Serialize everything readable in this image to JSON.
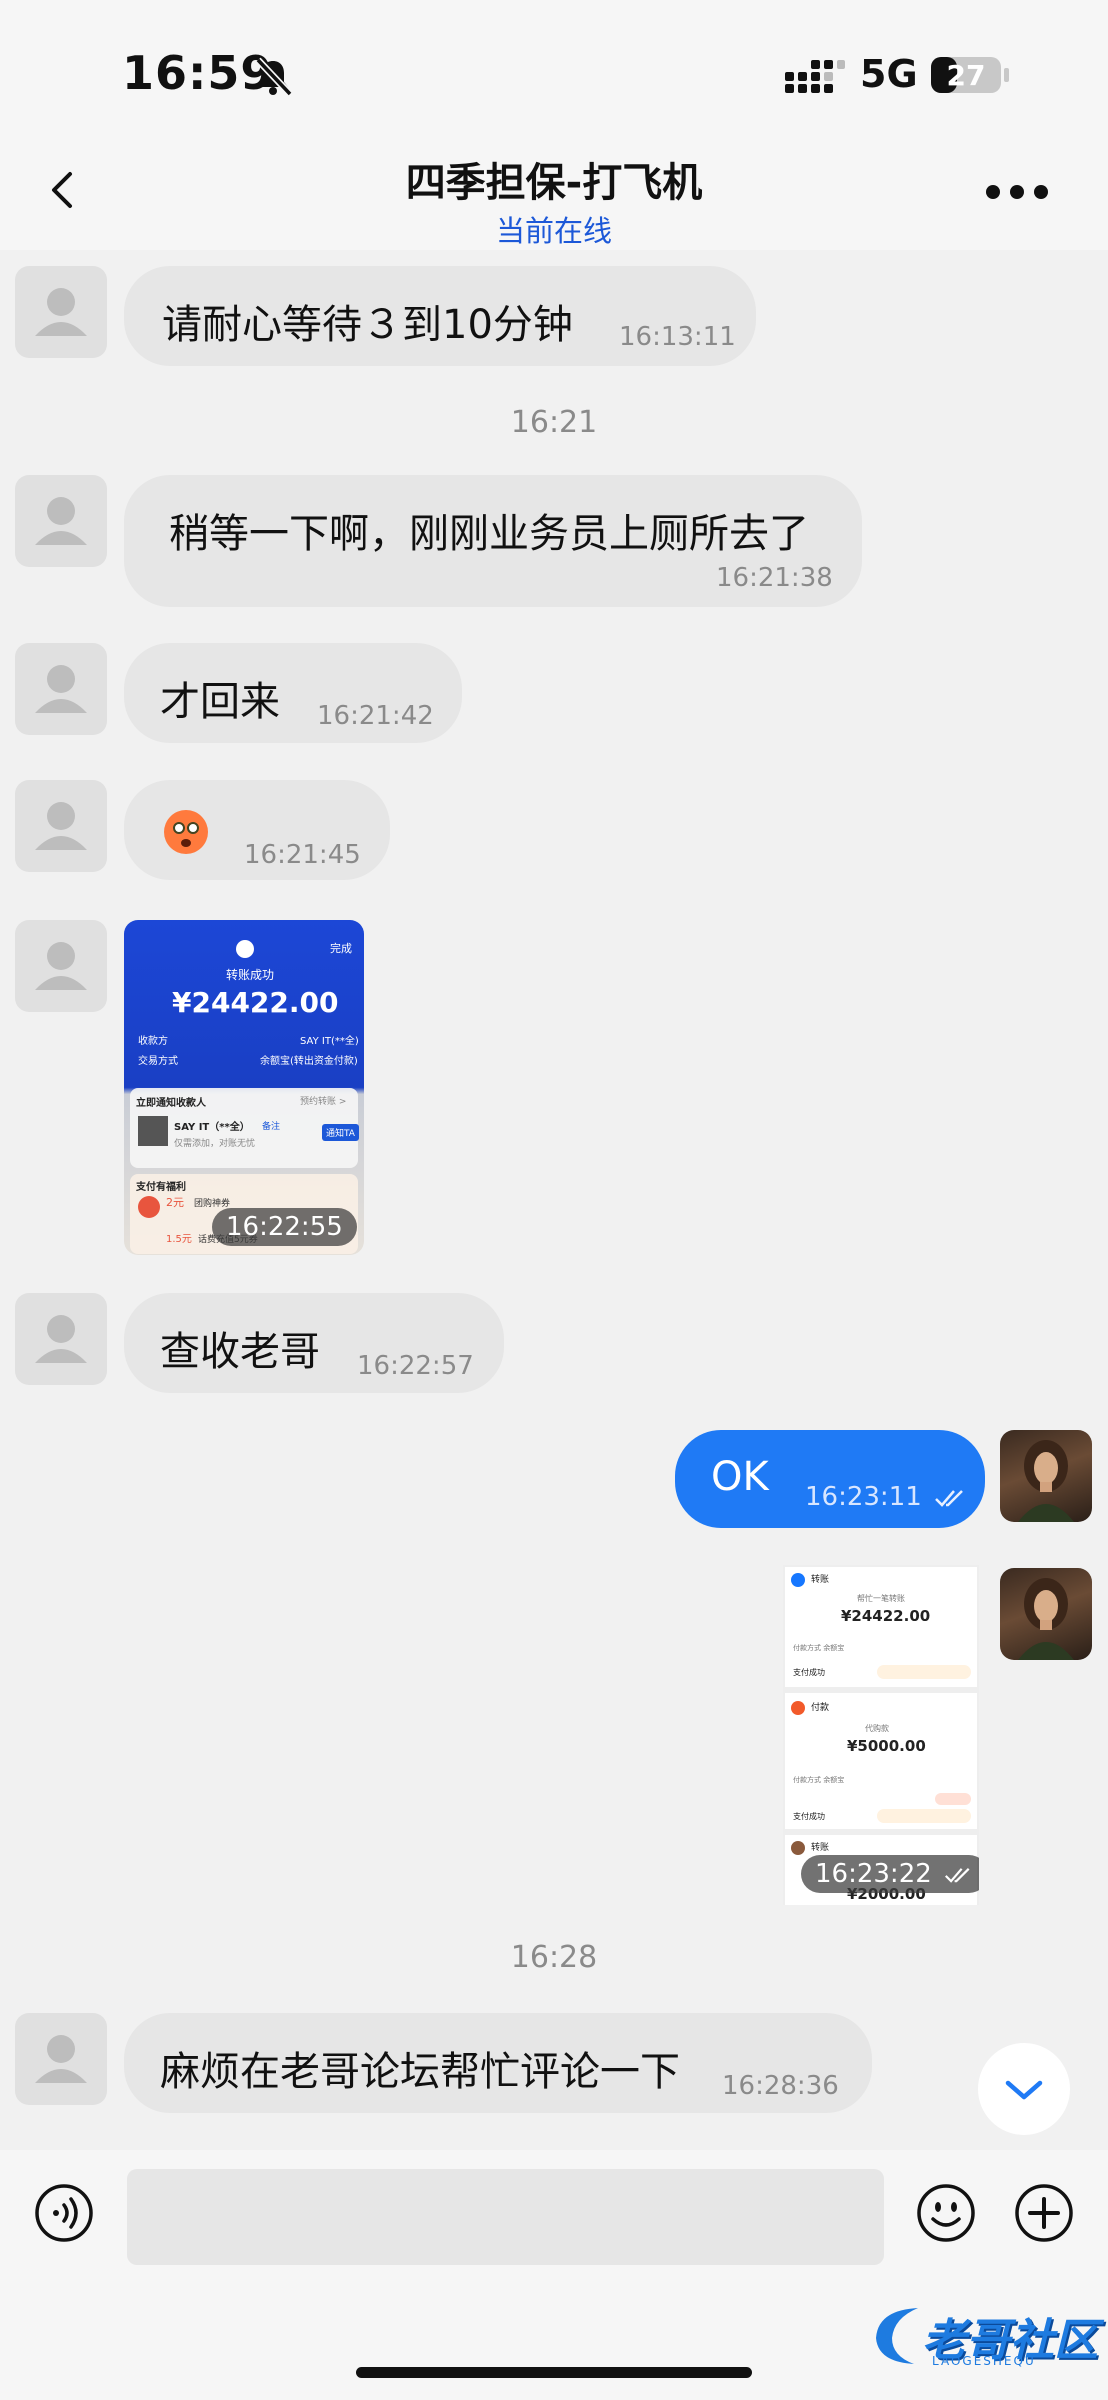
{
  "status_bar": {
    "time": "16:59",
    "network": "5G",
    "battery": "27"
  },
  "header": {
    "title": "四季担保-打飞机",
    "subtitle": "当前在线"
  },
  "messages": {
    "m1": {
      "text": "请耐心等待３到10分钟",
      "time": "16:13:11"
    },
    "sep1": "16:21",
    "m2": {
      "text": "稍等一下啊，刚刚业务员上厕所去了",
      "time": "16:21:38"
    },
    "m3": {
      "text": "才回来",
      "time": "16:21:42"
    },
    "m4": {
      "time": "16:21:45"
    },
    "m5": {
      "time": "16:22:55",
      "image": {
        "status": "转账成功",
        "amount": "¥24422.00",
        "done": "完成",
        "payee_label": "收款方",
        "payee_value": "SAY IT(**全)",
        "method_label": "交易方式",
        "method_value": "余额宝(转出资金付款)",
        "notify": "立即通知收款人",
        "remind": "预约转账 >",
        "contact": "SAY IT（**全）",
        "contact_tag": "备注",
        "contact_desc": "仅需添加，对账无忧",
        "notify_btn": "通知TA",
        "benefit": "支付有福利",
        "coupon1": "2元",
        "coupon1_desc": "团购神券",
        "coupon2": "1.5元",
        "coupon2_desc": "话费充值5元券"
      }
    },
    "m6": {
      "text": "查收老哥",
      "time": "16:22:57"
    },
    "m7": {
      "text": "OK",
      "time": "16:23:11"
    },
    "m8": {
      "time": "16:23:22",
      "image": {
        "r1_title": "转账",
        "r1_sub": "帮忙一笔转账",
        "r1_amount": "¥24422.00",
        "r1_row": "付款方式  余额宝",
        "r1_status": "支付成功",
        "r2_title": "付款",
        "r2_sub": "代购款",
        "r2_amount": "¥5000.00",
        "r2_row": "付款方式  余额宝",
        "r2_status": "支付成功",
        "r3_title": "转账",
        "r3_amount": "¥2000.00"
      }
    },
    "sep2": "16:28",
    "m9": {
      "text": "麻烦在老哥论坛帮忙评论一下",
      "time": "16:28:36"
    }
  },
  "watermark": {
    "title": "老哥社区",
    "subtitle": "LAOGESHEQU"
  },
  "icons": [
    "bell-slash-icon",
    "signal-icon",
    "battery-icon",
    "back-icon",
    "more-icon",
    "voice-icon",
    "emoji-icon",
    "plus-icon",
    "chevron-down-icon"
  ]
}
